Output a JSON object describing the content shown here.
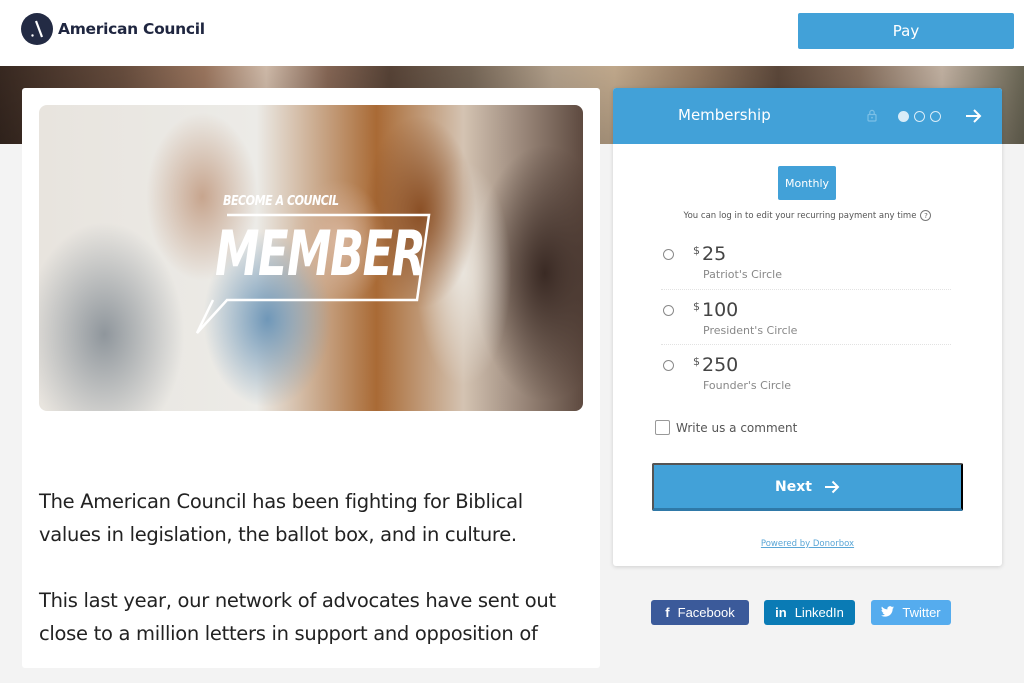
{
  "header": {
    "brand_name": "American Council",
    "logo_icon": "american-council-logo-icon",
    "pay_label": "Pay"
  },
  "hero": {
    "banner_tag": "BECOME A COUNCIL",
    "banner_title": "MEMBER"
  },
  "article": {
    "paragraphs": [
      "The American Council has been fighting for Biblical values in legislation, the ballot box, and in culture.",
      "This last year, our network of advocates have sent out close to a million letters in support and opposition of"
    ]
  },
  "donation_form": {
    "title": "Membership",
    "icons": {
      "lock": "lock-icon",
      "next": "arrow-right-icon"
    },
    "steps": {
      "current": 1,
      "total": 3
    },
    "frequency_label": "Monthly",
    "login_note": "You can log in to edit your recurring payment any time",
    "help_icon_text": "?",
    "currency_symbol": "$",
    "options": [
      {
        "amount": "25",
        "tier": "Patriot's Circle",
        "selected": false
      },
      {
        "amount": "100",
        "tier": "President's Circle",
        "selected": false
      },
      {
        "amount": "250",
        "tier": "Founder's Circle",
        "selected": false
      }
    ],
    "comment_label": "Write us a comment",
    "next_label": "Next",
    "powered_by": "Powered by Donorbox"
  },
  "share": {
    "facebook": {
      "icon": "f",
      "label": "Facebook"
    },
    "linkedin": {
      "icon": "in",
      "label": "LinkedIn"
    },
    "twitter": {
      "icon": "🐦",
      "label": "Twitter"
    }
  },
  "colors": {
    "accent": "#42a1d8",
    "brand_dark": "#232b44",
    "facebook": "#3b5a9a",
    "linkedin": "#0a7bb5",
    "twitter": "#55acee"
  }
}
